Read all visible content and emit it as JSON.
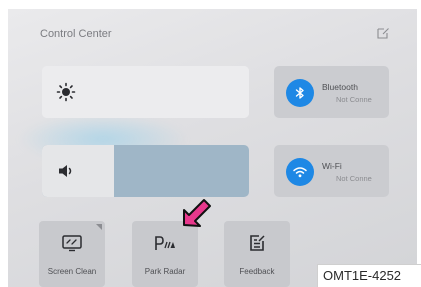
{
  "control_center": {
    "title": "Control Center",
    "brightness": {
      "icon": "brightness-icon",
      "level": 1.0
    },
    "volume": {
      "icon": "speaker-icon",
      "level": 0.35
    },
    "bluetooth": {
      "icon": "bluetooth-icon",
      "name": "Bluetooth",
      "status": "Not Conne"
    },
    "wifi": {
      "icon": "wifi-icon",
      "name": "Wi-Fi",
      "status": "Not Conne"
    },
    "tiles": [
      {
        "label": "Screen Clean",
        "icon": "screen-clean-icon"
      },
      {
        "label": "Park Radar",
        "icon": "park-radar-icon"
      },
      {
        "label": "Feedback",
        "icon": "feedback-icon"
      }
    ]
  },
  "figure_code": "OMT1E-4252",
  "colors": {
    "accent_blue": "#1e88e5",
    "volume_track": "#9fb6c7",
    "pointer_arrow": "#e8388c"
  }
}
